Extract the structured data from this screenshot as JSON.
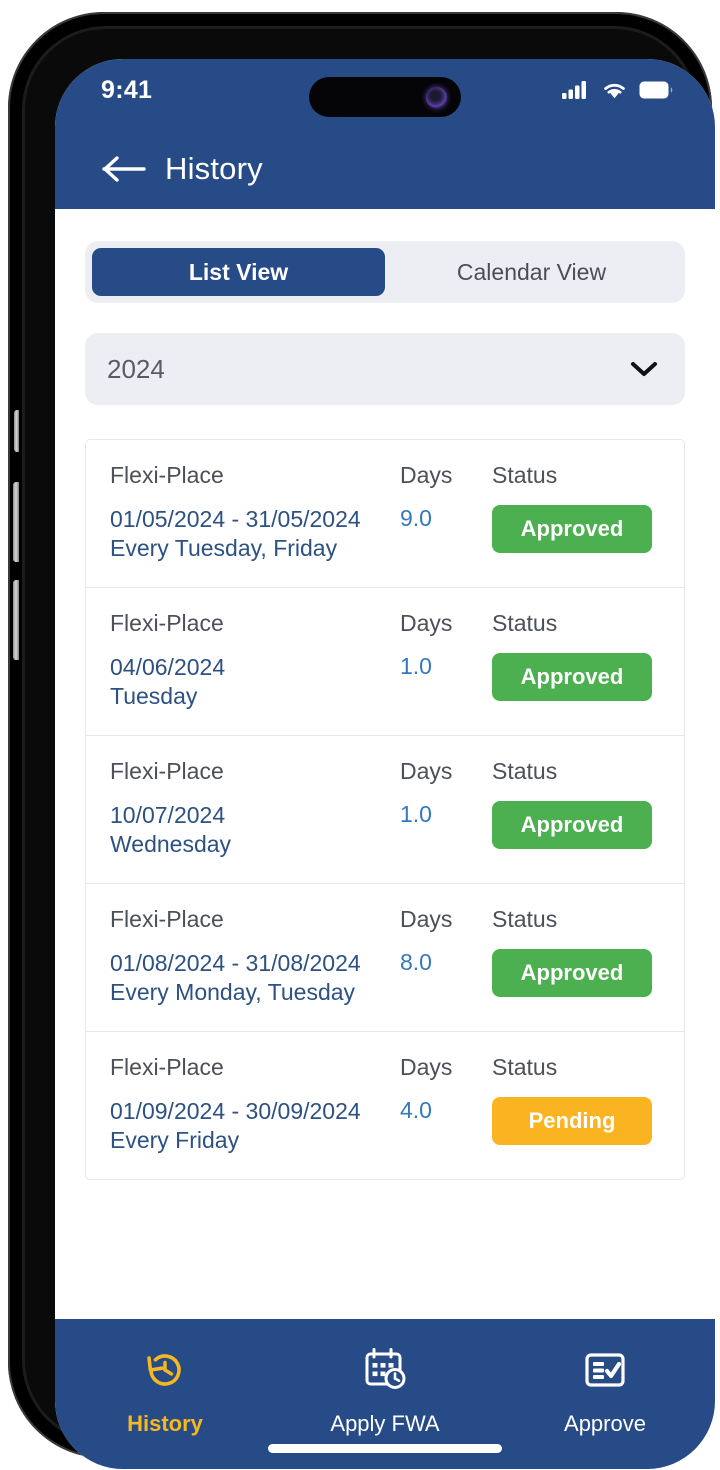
{
  "status_bar": {
    "time": "9:41",
    "icons": [
      "cellular-signal-icon",
      "wifi-icon",
      "battery-icon"
    ]
  },
  "header": {
    "back_icon": "back-arrow-icon",
    "title": "History",
    "background_color": "#274B87"
  },
  "view_toggle": {
    "options": [
      {
        "label": "List View",
        "active": true
      },
      {
        "label": "Calendar View",
        "active": false
      }
    ]
  },
  "year_filter": {
    "value": "2024",
    "chevron_icon": "chevron-down-icon"
  },
  "history_list": {
    "columns": {
      "type": "Flexi-Place",
      "days": "Days",
      "status": "Status"
    },
    "rows": [
      {
        "type": "Flexi-Place",
        "days_label": "Days",
        "status_label": "Status",
        "date": "01/05/2024 - 31/05/2024",
        "recurrence": "Every Tuesday, Friday",
        "days": "9.0",
        "status": "Approved",
        "status_kind": "approved"
      },
      {
        "type": "Flexi-Place",
        "days_label": "Days",
        "status_label": "Status",
        "date": "04/06/2024",
        "recurrence": "Tuesday",
        "days": "1.0",
        "status": "Approved",
        "status_kind": "approved"
      },
      {
        "type": "Flexi-Place",
        "days_label": "Days",
        "status_label": "Status",
        "date": "10/07/2024",
        "recurrence": "Wednesday",
        "days": "1.0",
        "status": "Approved",
        "status_kind": "approved"
      },
      {
        "type": "Flexi-Place",
        "days_label": "Days",
        "status_label": "Status",
        "date": "01/08/2024 - 31/08/2024",
        "recurrence": "Every Monday, Tuesday",
        "days": "8.0",
        "status": "Approved",
        "status_kind": "approved"
      },
      {
        "type": "Flexi-Place",
        "days_label": "Days",
        "status_label": "Status",
        "date": "01/09/2024 - 30/09/2024",
        "recurrence": "Every Friday",
        "days": "4.0",
        "status": "Pending",
        "status_kind": "pending"
      }
    ]
  },
  "bottom_nav": {
    "items": [
      {
        "label": "History",
        "icon": "clock-rewind-icon",
        "active": true
      },
      {
        "label": "Apply FWA",
        "icon": "calendar-clock-icon",
        "active": false
      },
      {
        "label": "Approve",
        "icon": "checklist-icon",
        "active": false
      }
    ]
  },
  "colors": {
    "brand_blue": "#274B87",
    "approved_green": "#4CAF50",
    "pending_amber": "#FBB421",
    "active_nav": "#F5B820",
    "link_blue": "#2c5182"
  }
}
